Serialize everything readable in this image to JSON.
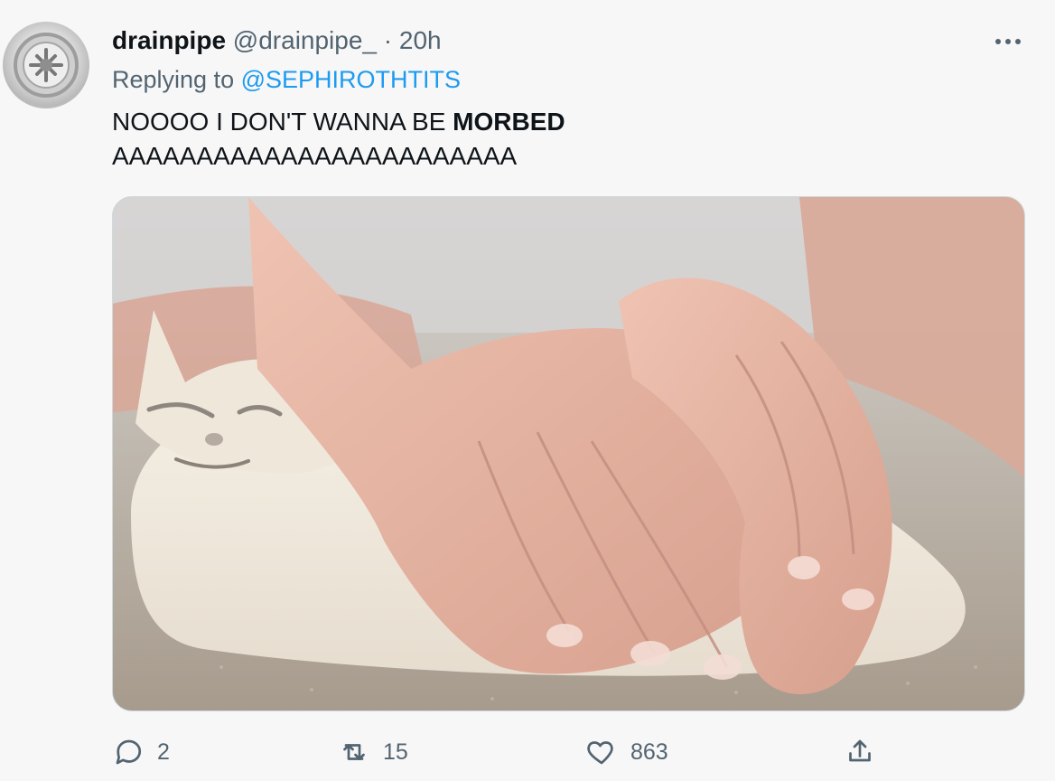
{
  "tweet": {
    "display_name": "drainpipe",
    "handle": "@drainpipe_",
    "separator": "·",
    "time": "20h",
    "reply_prefix": "Replying to",
    "reply_to": "@SEPHIROTHTITS",
    "text_line1": "NOOOO I DON'T WANNA BE ",
    "text_bold": "MORBED",
    "text_line2": "AAAAAAAAAAAAAAAAAAAAAAAA",
    "more_icon": "more-horizontal-icon",
    "avatar_icon": "drain-icon",
    "media_description_icon": "image"
  },
  "actions": {
    "reply_count": "2",
    "retweet_count": "15",
    "like_count": "863",
    "reply_icon": "reply-icon",
    "retweet_icon": "retweet-icon",
    "like_icon": "heart-icon",
    "share_icon": "share-icon"
  },
  "colors": {
    "text": "#0f1419",
    "secondary": "#536471",
    "link": "#1d9bf0",
    "background": "#f7f7f7"
  }
}
